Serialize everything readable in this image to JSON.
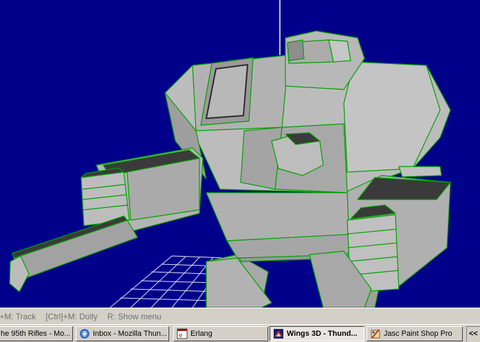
{
  "statusbar": {
    "hints": [
      "]+M: Track",
      "[Ctrl]+M: Dolly",
      "R: Show menu"
    ]
  },
  "taskbar": {
    "items": [
      {
        "label": "he 95th Rifles - Mo...",
        "icon": "browser-icon"
      },
      {
        "label": "Inbox - Mozilla Thun...",
        "icon": "thunderbird-icon"
      },
      {
        "label": "Erlang",
        "icon": "erlang-icon"
      },
      {
        "label": "Wings 3D - Thund...",
        "icon": "wings3d-icon",
        "active": true
      },
      {
        "label": "Jasc Paint Shop Pro",
        "icon": "paintshop-icon"
      }
    ],
    "tray_label": "<<"
  },
  "colors": {
    "viewport_bg": "#00008b",
    "mesh_face": "#b4b4b4",
    "mesh_edge": "#00a000",
    "grid": "#ffffff"
  }
}
